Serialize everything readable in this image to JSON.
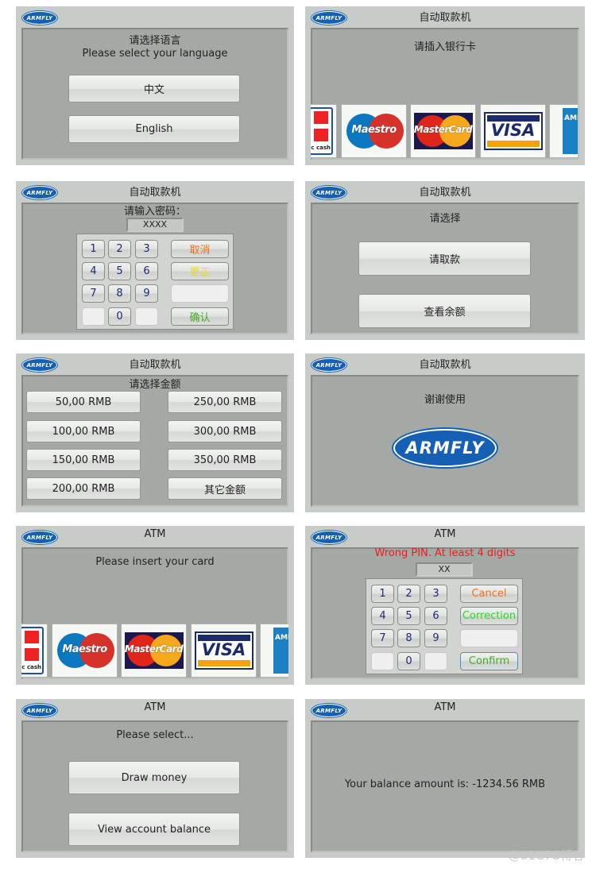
{
  "brand": "ARMFLY",
  "colors": {
    "frame": "#c8ccc8",
    "screen": "#a5a9a5",
    "cancel": "#f07020",
    "correction_cn": "#e8e000",
    "correction_en": "#22dd22",
    "confirm": "#44aa22",
    "error": "#ee1c1c",
    "key_digit": "#1e2878",
    "logo_blue": "#1560b4"
  },
  "panels": [
    {
      "title": "",
      "line1": "请选择语言",
      "line2": "Please select your language",
      "buttons": [
        "中文",
        "English"
      ]
    },
    {
      "title": "自动取款机",
      "message": "请插入银行卡",
      "cards": [
        "ec cash",
        "Maestro",
        "MasterCard",
        "VISA",
        "AMEX"
      ]
    },
    {
      "title": "自动取款机",
      "prompt": "请输入密码：",
      "pin": "XXXX",
      "keys": [
        "1",
        "2",
        "3",
        "4",
        "5",
        "6",
        "7",
        "8",
        "9",
        "0"
      ],
      "cancel": "取消",
      "correction": "更正",
      "confirm": "确认"
    },
    {
      "title": "自动取款机",
      "prompt": "请选择",
      "buttons": [
        "请取款",
        "查看余额"
      ]
    },
    {
      "title": "自动取款机",
      "prompt": "请选择金额",
      "amounts": [
        "50,00 RMB",
        "250,00 RMB",
        "100,00 RMB",
        "300,00 RMB",
        "150,00 RMB",
        "350,00 RMB",
        "200,00 RMB",
        "其它金额"
      ]
    },
    {
      "title": "自动取款机",
      "message": "谢谢使用",
      "logo": "ARMFLY"
    },
    {
      "title": "ATM",
      "message": "Please insert your card",
      "cards": [
        "ec cash",
        "Maestro",
        "MasterCard",
        "VISA",
        "AMEX"
      ]
    },
    {
      "title": "ATM",
      "error": "Wrong PIN. At least 4 digits",
      "pin": "XX",
      "keys": [
        "1",
        "2",
        "3",
        "4",
        "5",
        "6",
        "7",
        "8",
        "9",
        "0"
      ],
      "cancel": "Cancel",
      "correction": "Correction",
      "confirm": "Confirm"
    },
    {
      "title": "ATM",
      "prompt": "Please select...",
      "buttons": [
        "Draw money",
        "View account balance"
      ]
    },
    {
      "title": "ATM",
      "message": "Your balance amount is: -1234.56 RMB"
    }
  ],
  "watermark": "@51CTO博客"
}
